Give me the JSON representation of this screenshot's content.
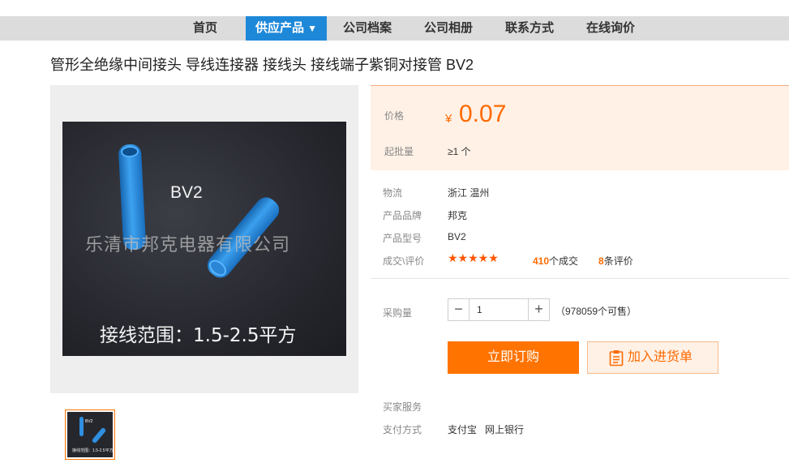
{
  "nav": {
    "items": [
      {
        "label": "首页"
      },
      {
        "label": "供应产品",
        "caret": "▼"
      },
      {
        "label": "公司档案"
      },
      {
        "label": "公司相册"
      },
      {
        "label": "联系方式"
      },
      {
        "label": "在线询价"
      }
    ]
  },
  "product": {
    "title": "管形全绝缘中间接头 导线连接器 接线头 接线端子紫铜对接管 BV2",
    "image": {
      "model_text": "BV2",
      "company_watermark": "乐清市邦克电器有限公司",
      "range_text": "接线范围：1.5-2.5平方"
    }
  },
  "price_panel": {
    "price_label": "价格",
    "currency": "¥",
    "price": "0.07",
    "moq_label": "起批量",
    "moq_value": "≥1 个"
  },
  "details": {
    "logistics_label": "物流",
    "logistics_value": "浙江 温州",
    "brand_label": "产品品牌",
    "brand_value": "邦克",
    "model_label": "产品型号",
    "model_value": "BV2",
    "deals_label": "成交\\评价",
    "stars": "★★★★★",
    "deals_count": "410",
    "deals_suffix": "个成交",
    "review_count": "8",
    "review_suffix": "条评价"
  },
  "purchase": {
    "qty_label": "采购量",
    "qty_value": "1",
    "minus": "−",
    "plus": "+",
    "available": "（978059个可售）",
    "buy_label": "立即订购",
    "cart_label": "加入进货单"
  },
  "services": {
    "buyer_service_label": "买家服务",
    "payment_label": "支付方式",
    "payment_value": "支付宝   网上银行"
  },
  "colors": {
    "accent": "#ff7300",
    "nav_active": "#1e88d8",
    "price_panel_bg": "#fff1e6"
  }
}
